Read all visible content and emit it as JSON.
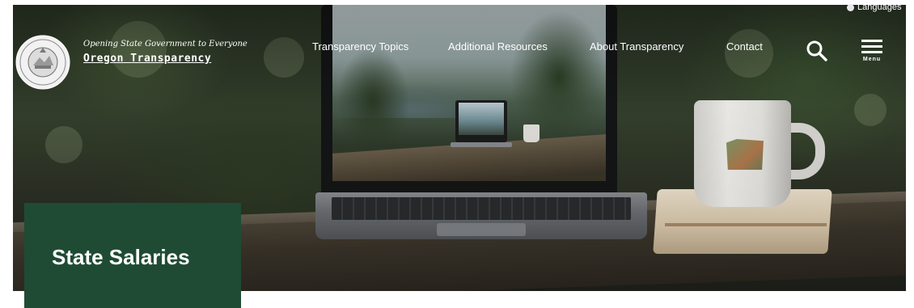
{
  "header": {
    "language_label": "Languages",
    "site_tagline": "Opening State Government to Everyone",
    "site_name": "Oregon Transparency",
    "nav": [
      {
        "label": "Transparency Topics"
      },
      {
        "label": "Additional Resources"
      },
      {
        "label": "About Transparency"
      },
      {
        "label": "Contact"
      }
    ],
    "menu_label": "Menu",
    "icons": {
      "seal": "state-seal-icon",
      "globe": "globe-icon",
      "search": "search-icon",
      "menu": "hamburger-menu-icon"
    }
  },
  "hero": {
    "page_title": "State Salaries"
  },
  "colors": {
    "title_box": "#1f4b34",
    "header_text": "#ffffff",
    "page_background": "#ffffff"
  }
}
